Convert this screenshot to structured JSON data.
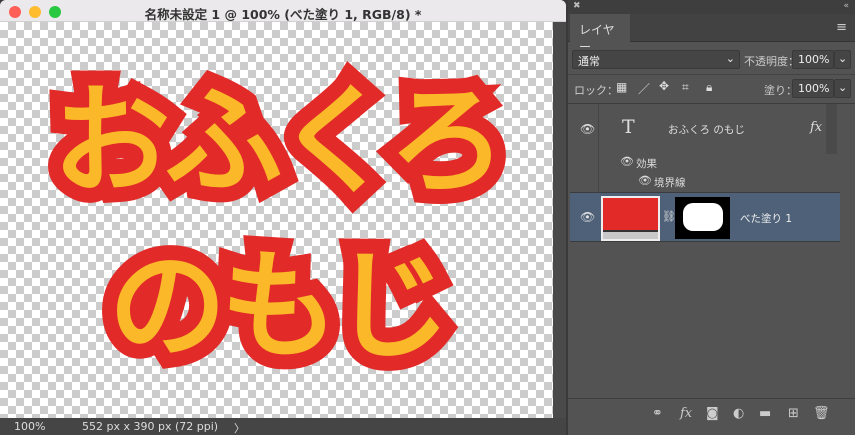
{
  "document": {
    "title": "名称未設定 1 @ 100% (べた塗り 1, RGB/8) *",
    "art_line1": "おふくろ",
    "art_line2": "のもじ",
    "zoom": "100%",
    "info": "552 px x 390 px (72 ppi)",
    "arrow": "〉"
  },
  "colors": {
    "fill": "#fbb829",
    "stroke": "#e22a28",
    "selected_layer": "#4e6179"
  },
  "panel": {
    "tab": "レイヤー",
    "blend_mode": "通常",
    "opacity_label": "不透明度：",
    "opacity": "100%",
    "lock_label": "ロック：",
    "fill_label": "塗り：",
    "fill": "100%",
    "layers": [
      {
        "name": "おふくろ のもじ",
        "type_icon": "T",
        "fx": "fx",
        "effects_label": "効果",
        "effect": "境界線"
      },
      {
        "name": "べた塗り 1"
      }
    ]
  }
}
